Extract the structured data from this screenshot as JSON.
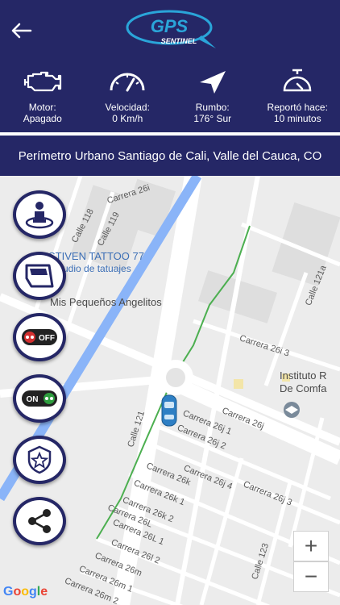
{
  "header": {
    "logo_text": "GPS",
    "logo_sub": "SENTINEL"
  },
  "stats": [
    {
      "label": "Motor:",
      "value": "Apagado",
      "icon": "engine-icon"
    },
    {
      "label": "Velocidad:",
      "value": "0 Km/h",
      "icon": "speedometer-icon"
    },
    {
      "label": "Rumbo:",
      "value": "176° Sur",
      "icon": "heading-arrow-icon"
    },
    {
      "label": "Reportó hace:",
      "value": "10 minutos",
      "icon": "timer-icon"
    }
  ],
  "address": "Perímetro Urbano Santiago de Cali, Valle del Cauca, CO",
  "map": {
    "streets": [
      "Carrera 26i",
      "Calle 118",
      "Calle 119",
      "Calle 121a",
      "Carrera 26i 3",
      "Carrera 26j",
      "Carrera 26j 1",
      "Carrera 26j 2",
      "Calle 121",
      "Carrera 26j 4",
      "Carrera 26k",
      "Carrera 26j 3",
      "Carrera 26k 1",
      "Carrera 26k 2",
      "Carrera 26L",
      "Carrera 26L 1",
      "Carrera 26l 2",
      "Carrera 26m",
      "Carrera 26m 1",
      "Carrera 26m 2",
      "Calle 123"
    ],
    "pois": [
      "STIVEN TATTOO 77",
      "udio de tatuajes",
      "Mis Pequeños Angelitos",
      "Instituto R",
      "De Comfa"
    ],
    "zoom_in": "+",
    "zoom_out": "−",
    "attribution": "Google"
  },
  "side_buttons": [
    {
      "name": "driver-button",
      "icon": "driver-icon"
    },
    {
      "name": "doors-button",
      "icon": "car-door-icon"
    },
    {
      "name": "engine-off-button",
      "icon": "off-switch-icon",
      "text": "OFF"
    },
    {
      "name": "engine-on-button",
      "icon": "on-switch-icon",
      "text": "ON"
    },
    {
      "name": "security-button",
      "icon": "shield-star-icon"
    },
    {
      "name": "share-button",
      "icon": "share-icon"
    }
  ],
  "colors": {
    "brand": "#252766",
    "accent": "#2aa5d9",
    "water": "#8ab4f8",
    "park": "#4caf50"
  }
}
